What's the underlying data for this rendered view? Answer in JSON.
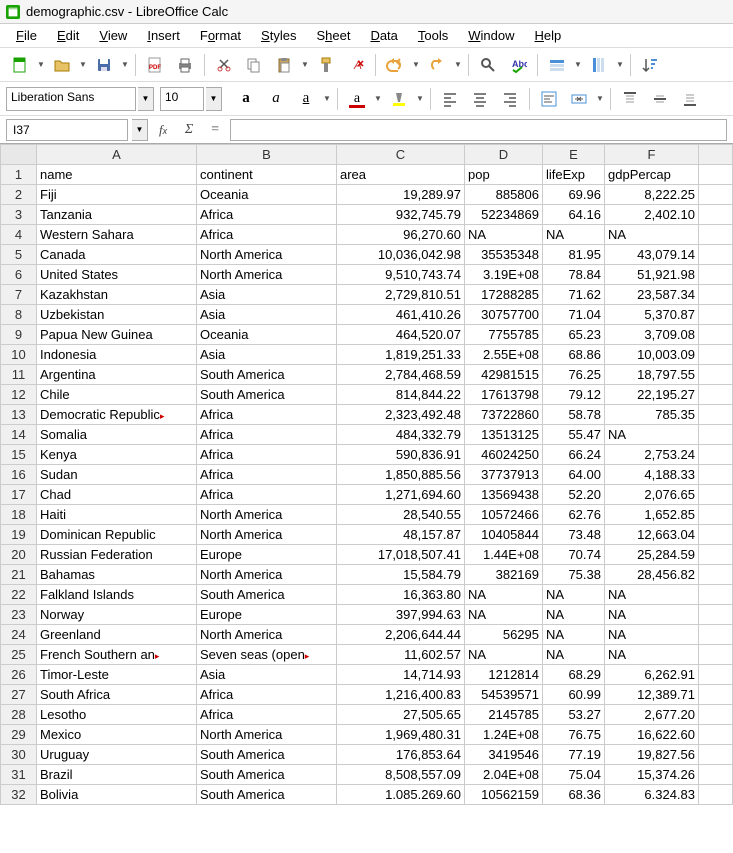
{
  "window": {
    "title": "demographic.csv - LibreOffice Calc"
  },
  "menu": {
    "file": {
      "pre": "",
      "ul": "F",
      "post": "ile"
    },
    "edit": {
      "pre": "",
      "ul": "E",
      "post": "dit"
    },
    "view": {
      "pre": "",
      "ul": "V",
      "post": "iew"
    },
    "insert": {
      "pre": "",
      "ul": "I",
      "post": "nsert"
    },
    "format": {
      "pre": "F",
      "ul": "o",
      "post": "rmat"
    },
    "styles": {
      "pre": "",
      "ul": "S",
      "post": "tyles"
    },
    "sheet": {
      "pre": "S",
      "ul": "h",
      "post": "eet"
    },
    "data": {
      "pre": "",
      "ul": "D",
      "post": "ata"
    },
    "tools": {
      "pre": "",
      "ul": "T",
      "post": "ools"
    },
    "window": {
      "pre": "",
      "ul": "W",
      "post": "indow"
    },
    "help": {
      "pre": "",
      "ul": "H",
      "post": "elp"
    }
  },
  "formatbar": {
    "fontname": "Liberation Sans",
    "fontsize": "10"
  },
  "formula": {
    "cellref": "I37",
    "value": ""
  },
  "columns": [
    "A",
    "B",
    "C",
    "D",
    "E",
    "F",
    ""
  ],
  "headers": [
    "name",
    "continent",
    "area",
    "pop",
    "lifeExp",
    "gdpPercap"
  ],
  "chart_data": {
    "type": "table",
    "columns": [
      "name",
      "continent",
      "area",
      "pop",
      "lifeExp",
      "gdpPercap"
    ],
    "rows": [
      [
        "Fiji",
        "Oceania",
        19289.97,
        885806,
        69.96,
        8222.25
      ],
      [
        "Tanzania",
        "Africa",
        932745.79,
        52234869,
        64.16,
        2402.1
      ],
      [
        "Western Sahara",
        "Africa",
        96270.6,
        "NA",
        "NA",
        "NA"
      ],
      [
        "Canada",
        "North America",
        10036042.98,
        35535348,
        81.95,
        43079.14
      ],
      [
        "United States",
        "North America",
        9510743.74,
        319000000.0,
        78.84,
        51921.98
      ],
      [
        "Kazakhstan",
        "Asia",
        2729810.51,
        17288285,
        71.62,
        23587.34
      ],
      [
        "Uzbekistan",
        "Asia",
        461410.26,
        30757700,
        71.04,
        5370.87
      ],
      [
        "Papua New Guinea",
        "Oceania",
        464520.07,
        7755785,
        65.23,
        3709.08
      ],
      [
        "Indonesia",
        "Asia",
        1819251.33,
        255000000.0,
        68.86,
        10003.09
      ],
      [
        "Argentina",
        "South America",
        2784468.59,
        42981515,
        76.25,
        18797.55
      ],
      [
        "Chile",
        "South America",
        814844.22,
        17613798,
        79.12,
        22195.27
      ],
      [
        "Democratic Republic of the Congo",
        "Africa",
        2323492.48,
        73722860,
        58.78,
        785.35
      ],
      [
        "Somalia",
        "Africa",
        484332.79,
        13513125,
        55.47,
        "NA"
      ],
      [
        "Kenya",
        "Africa",
        590836.91,
        46024250,
        66.24,
        2753.24
      ],
      [
        "Sudan",
        "Africa",
        1850885.56,
        37737913,
        64.0,
        4188.33
      ],
      [
        "Chad",
        "Africa",
        1271694.6,
        13569438,
        52.2,
        2076.65
      ],
      [
        "Haiti",
        "North America",
        28540.55,
        10572466,
        62.76,
        1652.85
      ],
      [
        "Dominican Republic",
        "North America",
        48157.87,
        10405844,
        73.48,
        12663.04
      ],
      [
        "Russian Federation",
        "Europe",
        17018507.41,
        144000000.0,
        70.74,
        25284.59
      ],
      [
        "Bahamas",
        "North America",
        15584.79,
        382169,
        75.38,
        28456.82
      ],
      [
        "Falkland Islands",
        "South America",
        16363.8,
        "NA",
        "NA",
        "NA"
      ],
      [
        "Norway",
        "Europe",
        397994.63,
        "NA",
        "NA",
        "NA"
      ],
      [
        "Greenland",
        "North America",
        2206644.44,
        56295,
        "NA",
        "NA"
      ],
      [
        "French Southern and Antarctic Lands",
        "Seven seas (open ocean)",
        11602.57,
        "NA",
        "NA",
        "NA"
      ],
      [
        "Timor-Leste",
        "Asia",
        14714.93,
        1212814,
        68.29,
        6262.91
      ],
      [
        "South Africa",
        "Africa",
        1216400.83,
        54539571,
        60.99,
        12389.71
      ],
      [
        "Lesotho",
        "Africa",
        27505.65,
        2145785,
        53.27,
        2677.2
      ],
      [
        "Mexico",
        "North America",
        1969480.31,
        124000000.0,
        76.75,
        16622.6
      ],
      [
        "Uruguay",
        "South America",
        176853.64,
        3419546,
        77.19,
        19827.56
      ],
      [
        "Brazil",
        "South America",
        8508557.09,
        204000000.0,
        75.04,
        15374.26
      ],
      [
        "Bolivia",
        "South America",
        1085269.6,
        10562159,
        68.36,
        6324.83
      ]
    ]
  },
  "display_rows": [
    {
      "n": "2",
      "a": "Fiji",
      "b": "Oceania",
      "c": "19,289.97",
      "d": "885806",
      "e": "69.96",
      "f": "8,222.25"
    },
    {
      "n": "3",
      "a": "Tanzania",
      "b": "Africa",
      "c": "932,745.79",
      "d": "52234869",
      "e": "64.16",
      "f": "2,402.10"
    },
    {
      "n": "4",
      "a": "Western Sahara",
      "b": "Africa",
      "c": "96,270.60",
      "d": "NA",
      "e": "NA",
      "f": "NA",
      "dna": true,
      "ena": true,
      "fna": true
    },
    {
      "n": "5",
      "a": "Canada",
      "b": "North America",
      "c": "10,036,042.98",
      "d": "35535348",
      "e": "81.95",
      "f": "43,079.14"
    },
    {
      "n": "6",
      "a": "United States",
      "b": "North America",
      "c": "9,510,743.74",
      "d": "3.19E+08",
      "e": "78.84",
      "f": "51,921.98"
    },
    {
      "n": "7",
      "a": "Kazakhstan",
      "b": "Asia",
      "c": "2,729,810.51",
      "d": "17288285",
      "e": "71.62",
      "f": "23,587.34"
    },
    {
      "n": "8",
      "a": "Uzbekistan",
      "b": "Asia",
      "c": "461,410.26",
      "d": "30757700",
      "e": "71.04",
      "f": "5,370.87"
    },
    {
      "n": "9",
      "a": "Papua New Guinea",
      "b": "Oceania",
      "c": "464,520.07",
      "d": "7755785",
      "e": "65.23",
      "f": "3,709.08"
    },
    {
      "n": "10",
      "a": "Indonesia",
      "b": "Asia",
      "c": "1,819,251.33",
      "d": "2.55E+08",
      "e": "68.86",
      "f": "10,003.09"
    },
    {
      "n": "11",
      "a": "Argentina",
      "b": "South America",
      "c": "2,784,468.59",
      "d": "42981515",
      "e": "76.25",
      "f": "18,797.55"
    },
    {
      "n": "12",
      "a": "Chile",
      "b": "South America",
      "c": "814,844.22",
      "d": "17613798",
      "e": "79.12",
      "f": "22,195.27"
    },
    {
      "n": "13",
      "a": "Democratic Republic",
      "aov": true,
      "b": "Africa",
      "c": "2,323,492.48",
      "d": "73722860",
      "e": "58.78",
      "f": "785.35"
    },
    {
      "n": "14",
      "a": "Somalia",
      "b": "Africa",
      "c": "484,332.79",
      "d": "13513125",
      "e": "55.47",
      "f": "NA",
      "fna": true
    },
    {
      "n": "15",
      "a": "Kenya",
      "b": "Africa",
      "c": "590,836.91",
      "d": "46024250",
      "e": "66.24",
      "f": "2,753.24"
    },
    {
      "n": "16",
      "a": "Sudan",
      "b": "Africa",
      "c": "1,850,885.56",
      "d": "37737913",
      "e": "64.00",
      "f": "4,188.33"
    },
    {
      "n": "17",
      "a": "Chad",
      "b": "Africa",
      "c": "1,271,694.60",
      "d": "13569438",
      "e": "52.20",
      "f": "2,076.65"
    },
    {
      "n": "18",
      "a": "Haiti",
      "b": "North America",
      "c": "28,540.55",
      "d": "10572466",
      "e": "62.76",
      "f": "1,652.85"
    },
    {
      "n": "19",
      "a": "Dominican Republic",
      "b": "North America",
      "c": "48,157.87",
      "d": "10405844",
      "e": "73.48",
      "f": "12,663.04"
    },
    {
      "n": "20",
      "a": "Russian Federation",
      "b": "Europe",
      "c": "17,018,507.41",
      "d": "1.44E+08",
      "e": "70.74",
      "f": "25,284.59"
    },
    {
      "n": "21",
      "a": "Bahamas",
      "b": "North America",
      "c": "15,584.79",
      "d": "382169",
      "e": "75.38",
      "f": "28,456.82"
    },
    {
      "n": "22",
      "a": "Falkland Islands",
      "b": "South America",
      "c": "16,363.80",
      "d": "NA",
      "e": "NA",
      "f": "NA",
      "dna": true,
      "ena": true,
      "fna": true
    },
    {
      "n": "23",
      "a": "Norway",
      "b": "Europe",
      "c": "397,994.63",
      "d": "NA",
      "e": "NA",
      "f": "NA",
      "dna": true,
      "ena": true,
      "fna": true
    },
    {
      "n": "24",
      "a": "Greenland",
      "b": "North America",
      "c": "2,206,644.44",
      "d": "56295",
      "e": "NA",
      "f": "NA",
      "ena": true,
      "fna": true
    },
    {
      "n": "25",
      "a": "French Southern an",
      "aov": true,
      "b": "Seven seas (open",
      "bov": true,
      "c": "11,602.57",
      "d": "NA",
      "e": "NA",
      "f": "NA",
      "dna": true,
      "ena": true,
      "fna": true
    },
    {
      "n": "26",
      "a": "Timor-Leste",
      "b": "Asia",
      "c": "14,714.93",
      "d": "1212814",
      "e": "68.29",
      "f": "6,262.91"
    },
    {
      "n": "27",
      "a": "South Africa",
      "b": "Africa",
      "c": "1,216,400.83",
      "d": "54539571",
      "e": "60.99",
      "f": "12,389.71"
    },
    {
      "n": "28",
      "a": "Lesotho",
      "b": "Africa",
      "c": "27,505.65",
      "d": "2145785",
      "e": "53.27",
      "f": "2,677.20"
    },
    {
      "n": "29",
      "a": "Mexico",
      "b": "North America",
      "c": "1,969,480.31",
      "d": "1.24E+08",
      "e": "76.75",
      "f": "16,622.60"
    },
    {
      "n": "30",
      "a": "Uruguay",
      "b": "South America",
      "c": "176,853.64",
      "d": "3419546",
      "e": "77.19",
      "f": "19,827.56"
    },
    {
      "n": "31",
      "a": "Brazil",
      "b": "South America",
      "c": "8,508,557.09",
      "d": "2.04E+08",
      "e": "75.04",
      "f": "15,374.26"
    },
    {
      "n": "32",
      "a": "Bolivia",
      "b": "South America",
      "c": "1.085.269.60",
      "d": "10562159",
      "e": "68.36",
      "f": "6.324.83"
    }
  ]
}
